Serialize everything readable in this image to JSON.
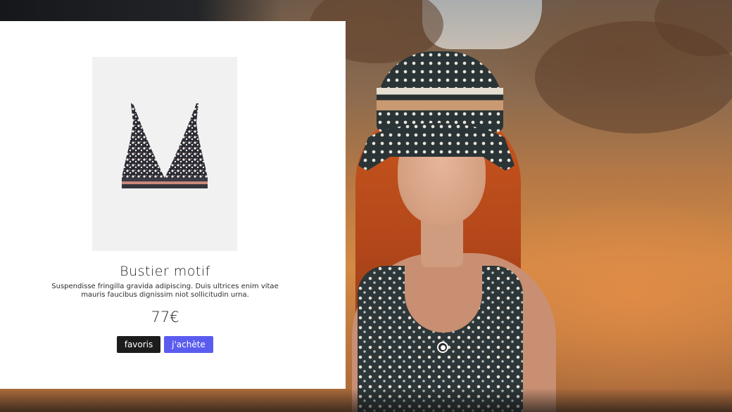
{
  "background": {
    "description_icon": "video-background",
    "accent_color": "#d38a45"
  },
  "product": {
    "title": "Bustier motif",
    "description": "Suspendisse fringilla gravida adipiscing. Duis ultrices enim vitae mauris faucibus dignissim niot sollicitudin urna.",
    "price": "77€",
    "image_icon": "bra-top-product-image"
  },
  "actions": {
    "favorite_label": "favoris",
    "buy_label": "j'achète",
    "buy_color": "#5a5cf0",
    "favorite_color": "#1c1c1c"
  },
  "scroll_indicator": {
    "icon": "scroll-dot-icon"
  }
}
